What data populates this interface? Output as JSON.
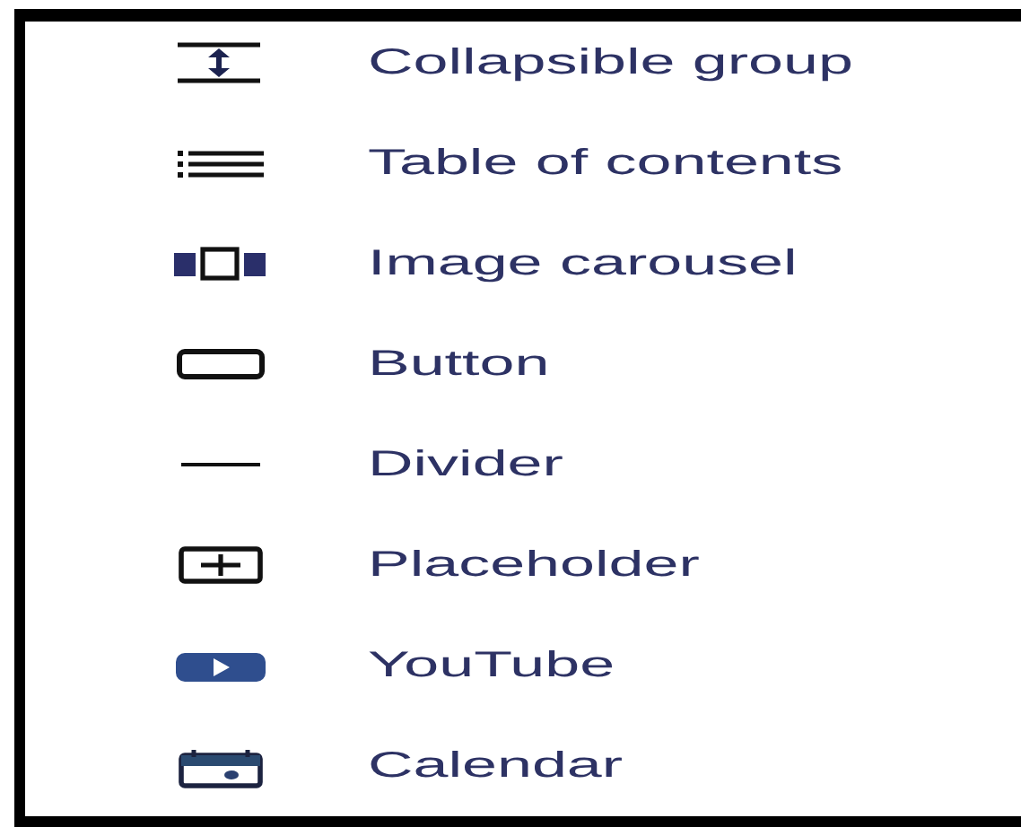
{
  "items": [
    {
      "label": "Collapsible group",
      "kind": "collapse"
    },
    {
      "label": "Table of contents",
      "kind": "toc"
    },
    {
      "label": "Image carousel",
      "kind": "carousel"
    },
    {
      "label": "Button",
      "kind": "button"
    },
    {
      "label": "Divider",
      "kind": "divider"
    },
    {
      "label": "Placeholder",
      "kind": "placeholder"
    },
    {
      "label": "YouTube",
      "kind": "youtube"
    },
    {
      "label": "Calendar",
      "kind": "calendar"
    }
  ]
}
